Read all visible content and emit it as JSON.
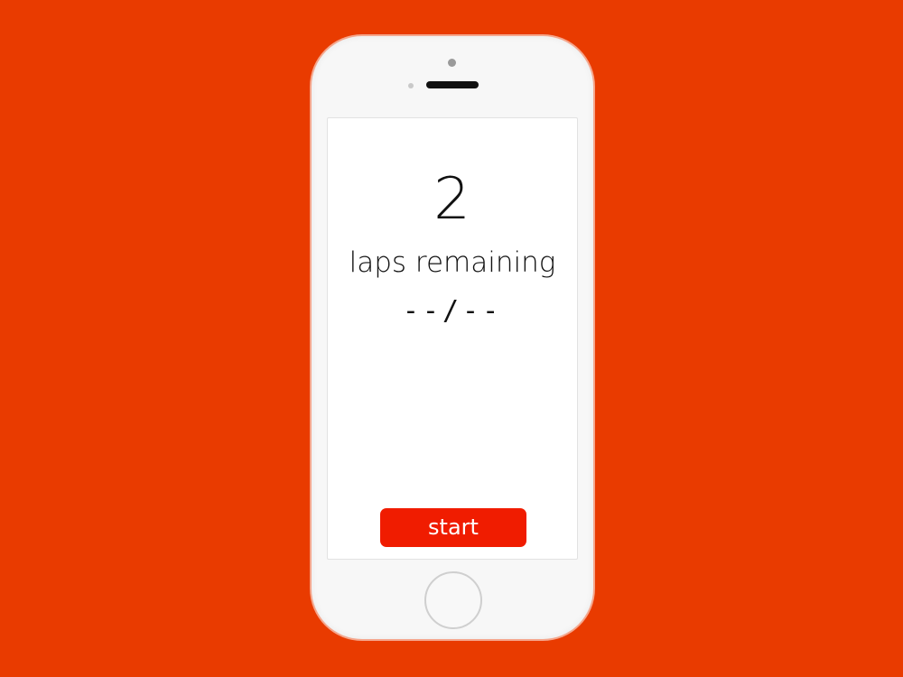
{
  "app": {
    "lap_count": "2",
    "lap_label": "laps remaining",
    "split_time": "--/--",
    "start_label": "start"
  },
  "colors": {
    "background": "#e93b00",
    "accent": "#f01c00"
  }
}
